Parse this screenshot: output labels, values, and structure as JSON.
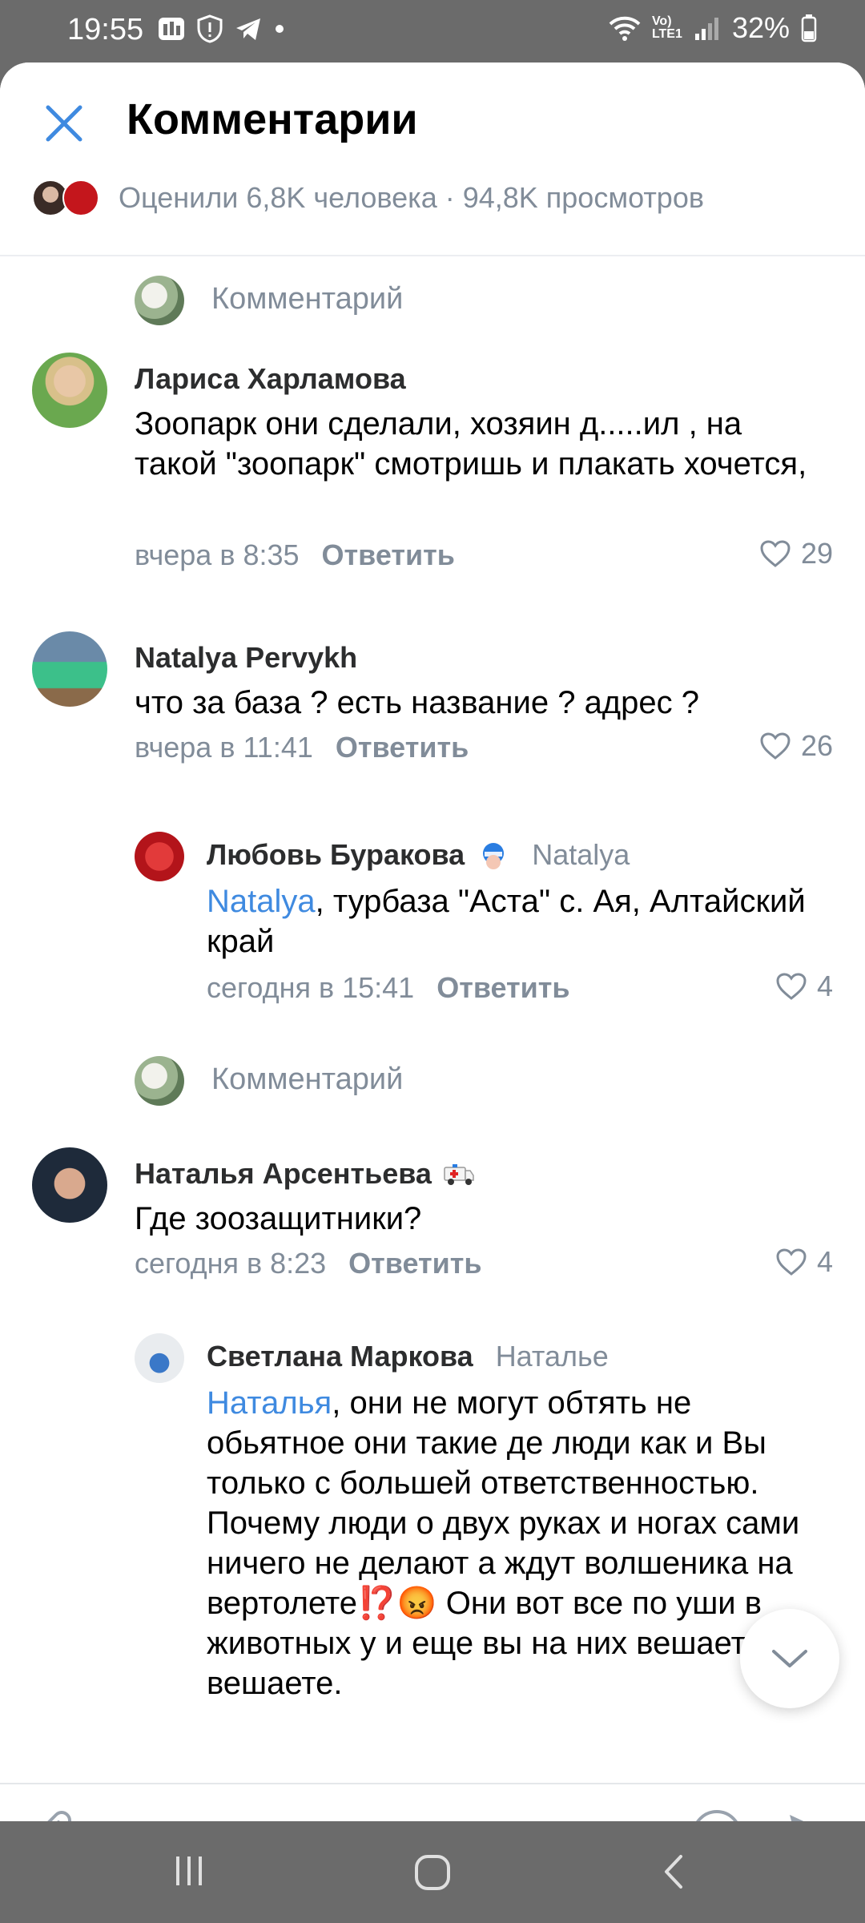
{
  "status_bar": {
    "time": "19:55",
    "network": "Vo) LTE1",
    "battery": "32%"
  },
  "header": {
    "title": "Комментарии",
    "stats": "Оценили 6,8K человека · 94,8K просмотров"
  },
  "placeholder_label": "Комментарий",
  "comments": [
    {
      "author": "Лариса Харламова",
      "text": "Зоопарк они сделали, хозяин д.....ил , на такой \"зоопарк\" смотришь и плакать хочется,",
      "time": "вчера в 8:35",
      "reply": "Ответить",
      "likes": "29"
    },
    {
      "author": "Natalya Pervykh",
      "text": "что за база ? есть название ? адрес ?",
      "time": "вчера в 11:41",
      "reply": "Ответить",
      "likes": "26"
    },
    {
      "author": "Любовь Буракова",
      "reply_to": "Natalya",
      "mention": "Natalya",
      "text": ", турбаза \"Аста\" с. Ая, Алтайский край",
      "time": "сегодня в 15:41",
      "reply": "Ответить",
      "likes": "4"
    },
    {
      "author": "Наталья Арсентьева",
      "text": "Где зоозащитники?",
      "time": "сегодня в 8:23",
      "reply": "Ответить",
      "likes": "4"
    },
    {
      "author": "Светлана Маркова",
      "reply_to": "Наталье",
      "mention": "Наталья",
      "text": ", они не могут обтять не обьятное они такие де люди как и Вы только с большей ответственностью. Почему люди о двух руках и ногах сами ничего не делают а ждут волшеника на вертолете⁉️😡 Они вот все по уши в животных у и еще вы на них вешаете и вешаете."
    }
  ],
  "composer": {
    "placeholder": "Комментарий"
  },
  "icons": {
    "close": "close-icon",
    "heart": "heart-icon",
    "attach": "paperclip-icon",
    "emoji": "smile-icon",
    "send": "send-icon",
    "scroll": "chevron-down-icon"
  },
  "colors": {
    "accent": "#3f8ae0",
    "secondary_text": "#818c99"
  }
}
